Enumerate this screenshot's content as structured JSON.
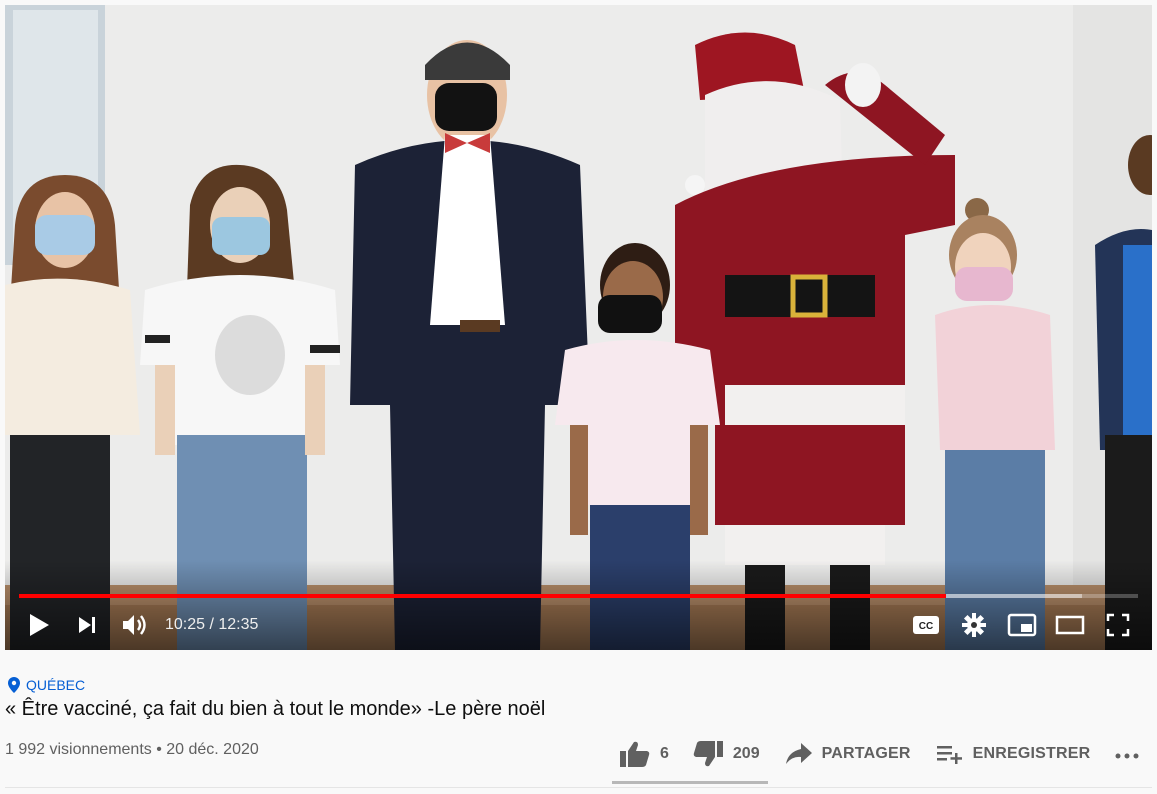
{
  "player": {
    "current_time": "10:25",
    "duration": "12:35",
    "time_display": "10:25 / 12:35",
    "progress_fraction": 0.828,
    "buffered_fraction": 0.95,
    "accent": "#ff0000"
  },
  "video": {
    "location": "QUÉBEC",
    "title": "« Être vacciné, ça fait du bien à tout le monde» -Le père noël",
    "views": "1 992 visionnements",
    "date": "20 déc. 2020",
    "meta_line": "1 992 visionnements • 20 déc. 2020"
  },
  "actions": {
    "likes": "6",
    "dislikes": "209",
    "share": "PARTAGER",
    "save": "ENREGISTRER"
  },
  "icons": {
    "play": "play-icon",
    "next": "next-icon",
    "volume": "volume-icon",
    "captions": "captions-icon",
    "settings": "gear-icon",
    "miniplayer": "miniplayer-icon",
    "theater": "theater-icon",
    "fullscreen": "fullscreen-icon",
    "location": "location-pin-icon",
    "like": "thumbs-up-icon",
    "dislike": "thumbs-down-icon",
    "share": "share-icon",
    "save": "playlist-add-icon",
    "more": "more-horizontal-icon"
  }
}
